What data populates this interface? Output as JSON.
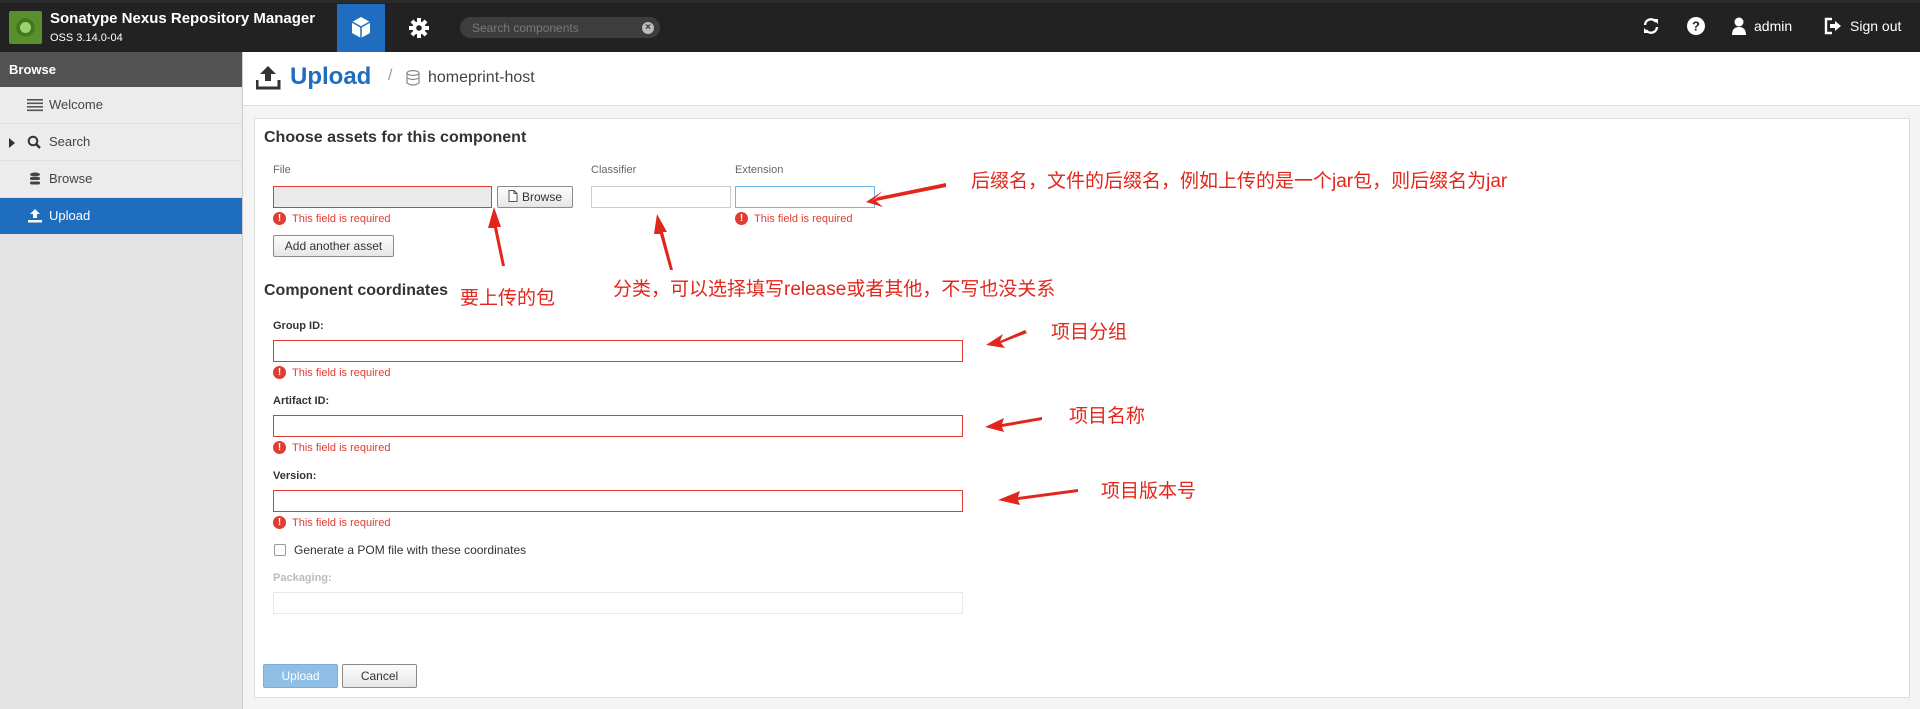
{
  "header": {
    "app_title": "Sonatype Nexus Repository Manager",
    "version": "OSS 3.14.0-04",
    "search_placeholder": "Search components",
    "username": "admin",
    "signout_label": "Sign out"
  },
  "sidebar": {
    "heading": "Browse",
    "items": [
      {
        "label": "Welcome",
        "icon": "list-icon"
      },
      {
        "label": "Search",
        "icon": "search-icon"
      },
      {
        "label": "Browse",
        "icon": "database-icon"
      },
      {
        "label": "Upload",
        "icon": "upload-icon"
      }
    ]
  },
  "breadcrumb": {
    "title": "Upload",
    "separator": "/",
    "repository": "homeprint-host"
  },
  "form": {
    "assets_title": "Choose assets for this component",
    "file_label": "File",
    "browse_label": "Browse",
    "classifier_label": "Classifier",
    "extension_label": "Extension",
    "required_msg": "This field is required",
    "add_asset_label": "Add another asset",
    "coords_title": "Component coordinates",
    "group_label": "Group ID:",
    "artifact_label": "Artifact ID:",
    "version_label": "Version:",
    "pom_label": "Generate a POM file with these coordinates",
    "packaging_label": "Packaging:",
    "upload_label": "Upload",
    "cancel_label": "Cancel"
  },
  "annotations": {
    "extension_note": "后缀名，文件的后缀名，例如上传的是一个jar包，则后缀名为jar",
    "file_note": "要上传的包",
    "classifier_note": "分类，可以选择填写release或者其他，不写也没关系",
    "group_note": "项目分组",
    "artifact_note": "项目名称",
    "version_note": "项目版本号"
  },
  "colors": {
    "accent": "#1e6dbe",
    "error": "#e03c31",
    "annotation": "#e3261b",
    "header_bg": "#222222"
  }
}
